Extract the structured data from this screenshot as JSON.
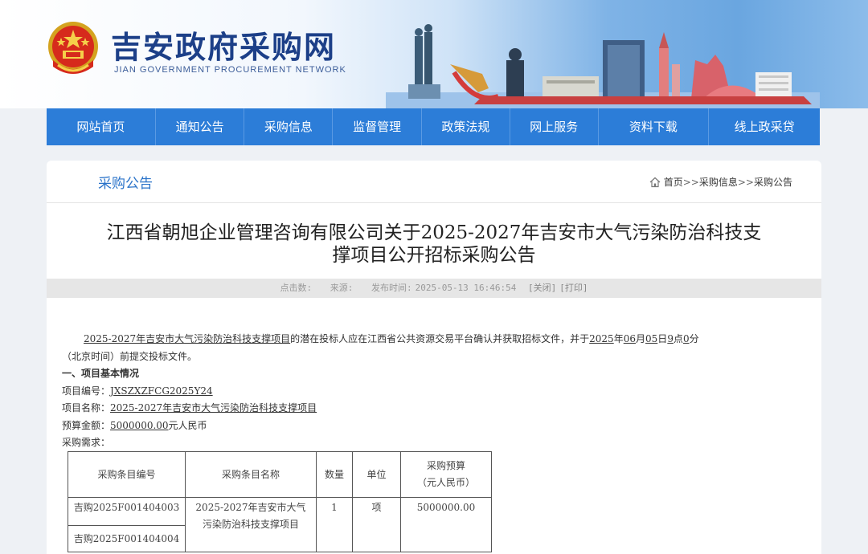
{
  "header": {
    "site_title": "吉安政府采购网",
    "site_subtitle": "JIAN GOVERNMENT PROCUREMENT NETWORK"
  },
  "nav": {
    "items": [
      "网站首页",
      "通知公告",
      "采购信息",
      "监督管理",
      "政策法规",
      "网上服务",
      "资料下载",
      "线上政采贷"
    ]
  },
  "section": {
    "title": "采购公告",
    "breadcrumb": [
      "首页",
      ">>",
      "采购信息",
      ">>",
      "采购公告"
    ]
  },
  "article": {
    "title_line1": "江西省朝旭企业管理咨询有限公司关于2025-2027年吉安市大气污染防治科技支",
    "title_line2": "撑项目公开招标采购公告",
    "meta": {
      "clicks_label": "点击数:",
      "source_label": "来源:",
      "publish_label": "发布时间:",
      "publish_time": "2025-05-13 16:46:54",
      "close": "[关闭]",
      "print": "[打印]"
    },
    "intro": {
      "project_link": "2025-2027年吉安市大气污染防治科技支撑项目",
      "text_a": "的潜在投标人应在江西省公共资源交易平台确认并获取招标文件，并于",
      "year": "2025",
      "year_unit": "年",
      "month": "06",
      "month_unit": "月",
      "day": "05",
      "day_unit": "日",
      "hour": "9",
      "hour_unit": "点",
      "minute": "0",
      "minute_unit": "分",
      "text_b": "（北京时间）前提交投标文件。"
    },
    "section1_heading": "一、项目基本情况",
    "project_no_label": "项目编号：",
    "project_no": "JXSZXZFCG2025Y24",
    "project_name_label": "项目名称：",
    "project_name": "2025-2027年吉安市大气污染防治科技支撑项目",
    "budget_label": "预算金额：",
    "budget_value": "5000000.00",
    "budget_unit": "元人民币",
    "demand_label": "采购需求：",
    "table": {
      "headers": [
        "采购条目编号",
        "采购条目名称",
        "数量",
        "单位",
        "采购预算"
      ],
      "header_budget_unit": "（元人民币）",
      "codes": [
        "吉购2025F001404003",
        "吉购2025F001404004"
      ],
      "name_line1": "2025-2027年吉安市大气",
      "name_line2": "污染防治科技支撑项目",
      "quantity": "1",
      "unit": "项",
      "budget": "5000000.00"
    }
  }
}
